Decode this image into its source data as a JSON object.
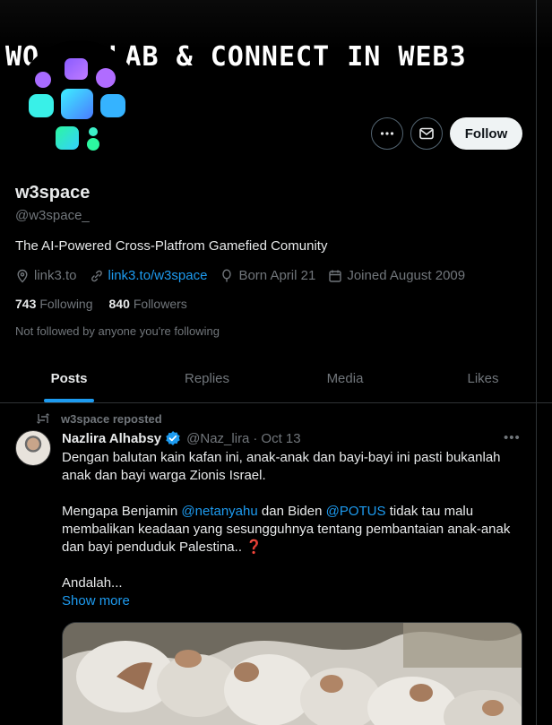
{
  "banner": {
    "text": "WO   COLLAB & CONNECT IN WEB3"
  },
  "profile": {
    "name": "w3space",
    "handle": "@w3space_",
    "bio": "The AI-Powered Cross-Platfrom Gamefied Comunity",
    "meta": {
      "location": "link3.to",
      "website": "link3.to/w3space",
      "born": "Born April 21",
      "joined": "Joined August 2009"
    },
    "following_count": "743",
    "following_label": "Following",
    "followers_count": "840",
    "followers_label": "Followers",
    "not_followed_text": "Not followed by anyone you're following"
  },
  "actions": {
    "follow_label": "Follow"
  },
  "tabs": [
    {
      "label": "Posts",
      "active": true
    },
    {
      "label": "Replies",
      "active": false
    },
    {
      "label": "Media",
      "active": false
    },
    {
      "label": "Likes",
      "active": false
    }
  ],
  "post": {
    "repost_label": "w3space reposted",
    "author_name": "Nazlira Alhabsy",
    "author_handle": "@Naz_lira",
    "separator": "·",
    "date": "Oct 13",
    "text_p1": "Dengan balutan kain kafan ini, anak-anak dan bayi-bayi ini pasti bukanlah anak dan bayi warga Zionis Israel.",
    "text_p2_a": "Mengapa Benjamin ",
    "mention_1": "@netanyahu",
    "text_p2_b": " dan Biden ",
    "mention_2": "@POTUS",
    "text_p2_c": " tidak tau malu membalikan keadaan yang sesungguhnya tentang pembantaian anak-anak dan bayi penduduk Palestina.. ",
    "question_mark": "❓",
    "text_p3": "Andalah...",
    "show_more": "Show more"
  },
  "colors": {
    "accent": "#1d9bf0",
    "text_primary": "#e7e9ea",
    "text_secondary": "#71767b",
    "border": "#2f3336"
  }
}
